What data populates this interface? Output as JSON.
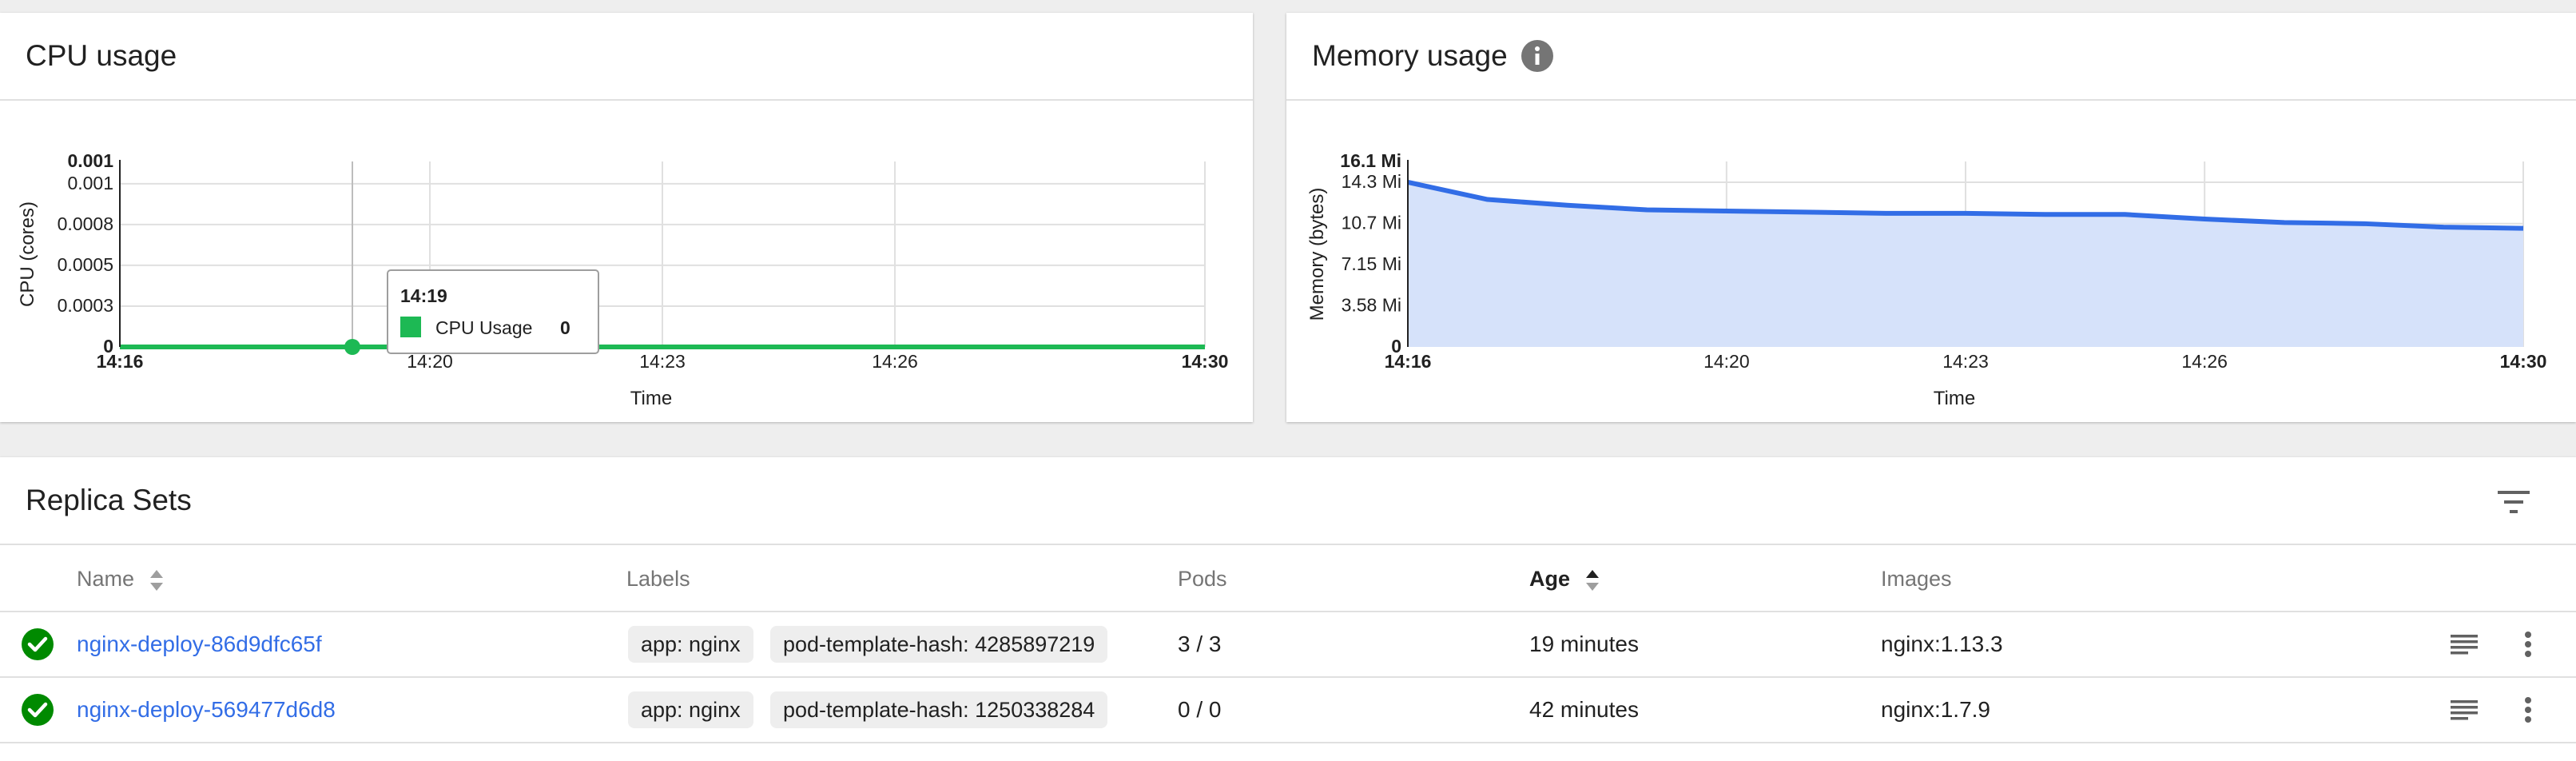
{
  "cpu_card": {
    "title": "CPU usage",
    "tooltip": {
      "time": "14:19",
      "series": "CPU Usage",
      "value": "0"
    }
  },
  "mem_card": {
    "title": "Memory usage",
    "info_icon": "info-icon"
  },
  "chart_data": [
    {
      "type": "line",
      "title": "CPU usage",
      "xlabel": "Time",
      "ylabel": "CPU (cores)",
      "x": [
        "14:16",
        "14:17",
        "14:18",
        "14:19",
        "14:20",
        "14:21",
        "14:22",
        "14:23",
        "14:24",
        "14:25",
        "14:26",
        "14:27",
        "14:28",
        "14:29",
        "14:30"
      ],
      "series": [
        {
          "name": "CPU Usage",
          "values": [
            0,
            0,
            0,
            0,
            0,
            0,
            0,
            0,
            0,
            0,
            0,
            0,
            0,
            0,
            0
          ]
        }
      ],
      "ylim": [
        0,
        0.001
      ],
      "y_ticks": [
        "0",
        "0.0003",
        "0.0005",
        "0.0008",
        "0.001",
        "0.001"
      ],
      "x_ticks": [
        "14:16",
        "14:20",
        "14:23",
        "14:26",
        "14:30"
      ],
      "grid": true,
      "color": "#1db954"
    },
    {
      "type": "area",
      "title": "Memory usage",
      "xlabel": "Time",
      "ylabel": "Memory (bytes)",
      "x": [
        "14:16",
        "14:17",
        "14:18",
        "14:19",
        "14:20",
        "14:21",
        "14:22",
        "14:23",
        "14:24",
        "14:25",
        "14:26",
        "14:27",
        "14:28",
        "14:29",
        "14:30"
      ],
      "series": [
        {
          "values": [
            14.3,
            12.8,
            12.3,
            11.9,
            11.8,
            11.7,
            11.6,
            11.6,
            11.5,
            11.5,
            11.1,
            10.8,
            10.7,
            10.4,
            10.3
          ]
        }
      ],
      "ylim": [
        0,
        16.1
      ],
      "y_ticks": [
        "0",
        "3.58 Mi",
        "7.15 Mi",
        "10.7 Mi",
        "14.3 Mi",
        "16.1 Mi"
      ],
      "x_ticks": [
        "14:16",
        "14:20",
        "14:23",
        "14:26",
        "14:30"
      ],
      "grid": true,
      "color": "#326de6",
      "fill": "#d6e2fa"
    }
  ],
  "replica_sets": {
    "title": "Replica Sets",
    "columns": {
      "name": "Name",
      "labels": "Labels",
      "pods": "Pods",
      "age": "Age",
      "images": "Images"
    },
    "rows": [
      {
        "name": "nginx-deploy-86d9dfc65f",
        "label1": "app: nginx",
        "label2": "pod-template-hash: 4285897219",
        "pods": "3 / 3",
        "age": "19 minutes",
        "image": "nginx:1.13.3"
      },
      {
        "name": "nginx-deploy-569477d6d8",
        "label1": "app: nginx",
        "label2": "pod-template-hash: 1250338284",
        "pods": "0 / 0",
        "age": "42 minutes",
        "image": "nginx:1.7.9"
      }
    ]
  }
}
